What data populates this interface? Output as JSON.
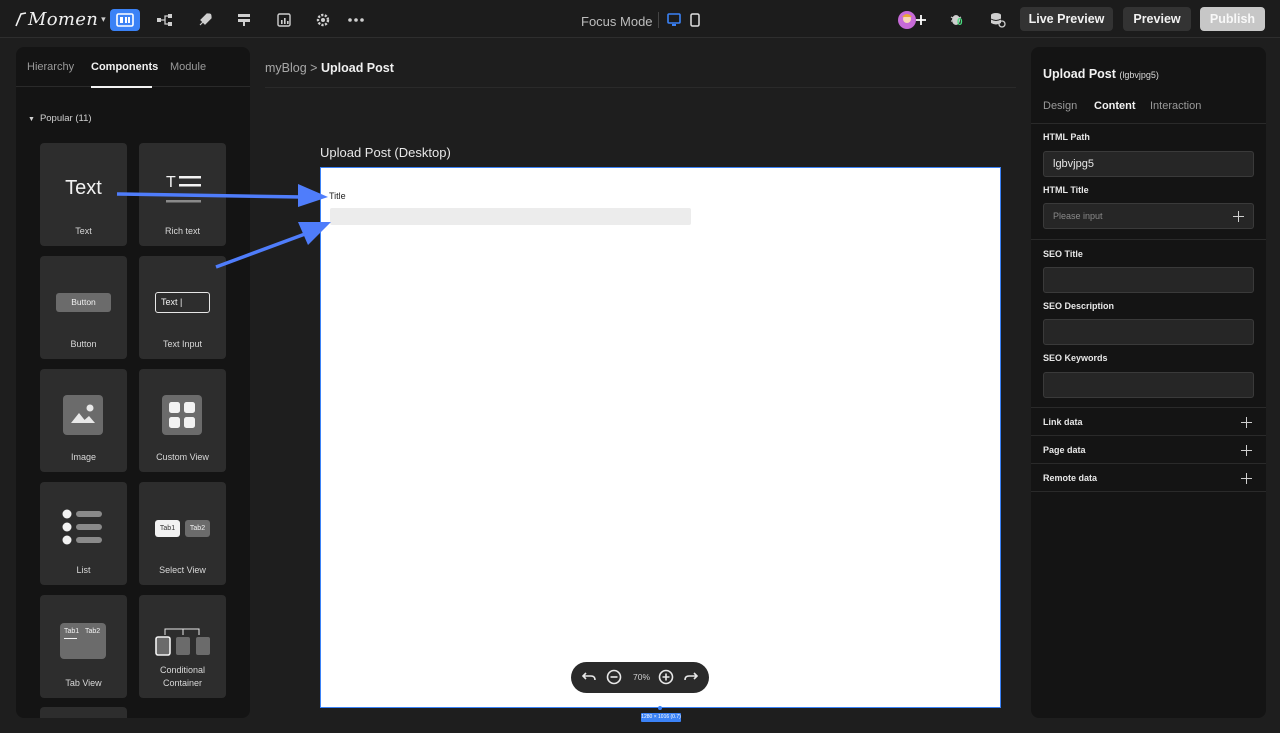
{
  "app": {
    "brand": "Momen",
    "focus_mode_label": "Focus Mode",
    "buttons": {
      "live_preview": "Live Preview",
      "preview": "Preview",
      "publish": "Publish"
    },
    "notification_count": "0",
    "accent_color": "#3b82f6"
  },
  "left_panel": {
    "tabs": [
      {
        "label": "Hierarchy"
      },
      {
        "label": "Components",
        "active": true
      },
      {
        "label": "Module"
      }
    ],
    "group": {
      "label": "Popular (11)"
    },
    "components": [
      {
        "label": "Text",
        "preview": "Text"
      },
      {
        "label": "Rich text",
        "preview": "T"
      },
      {
        "label": "Button",
        "preview": "Button"
      },
      {
        "label": "Text Input",
        "preview": "Text |"
      },
      {
        "label": "Image"
      },
      {
        "label": "Custom View"
      },
      {
        "label": "List"
      },
      {
        "label": "Select View",
        "tab1": "Tab1",
        "tab2": "Tab2"
      },
      {
        "label": "Tab View",
        "tab1": "Tab1",
        "tab2": "Tab2"
      },
      {
        "label_line1": "Conditional",
        "label_line2": "Container"
      }
    ]
  },
  "canvas": {
    "breadcrumb": {
      "parent": "myBlog",
      "separator": ">",
      "current": "Upload Post"
    },
    "frame_title": "Upload Post (Desktop)",
    "field_label": "Title",
    "zoom": "70%",
    "size_tag": "1280 × 1016 (0.7)"
  },
  "right_panel": {
    "title": "Upload Post",
    "page_id": "(lgbvjpg5)",
    "tabs": [
      {
        "label": "Design"
      },
      {
        "label": "Content",
        "active": true
      },
      {
        "label": "Interaction"
      }
    ],
    "html_path": {
      "label": "HTML Path",
      "value": "lgbvjpg5"
    },
    "html_title": {
      "label": "HTML Title",
      "placeholder": "Please input"
    },
    "seo_title": {
      "label": "SEO Title",
      "value": ""
    },
    "seo_description": {
      "label": "SEO Description",
      "value": ""
    },
    "seo_keywords": {
      "label": "SEO Keywords",
      "value": ""
    },
    "link_data": "Link data",
    "page_data": "Page data",
    "remote_data": "Remote data"
  }
}
